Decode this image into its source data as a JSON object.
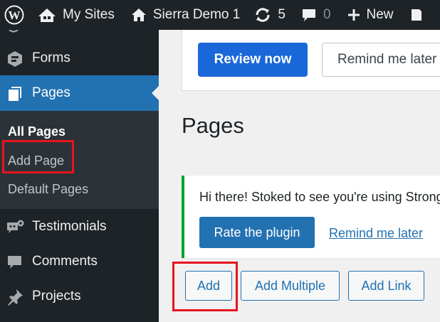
{
  "adminbar": {
    "my_sites": "My Sites",
    "site_name": "Sierra Demo 1",
    "updates_count": "5",
    "comments_count": "0",
    "new_label": "New"
  },
  "sidebar": {
    "items": [
      {
        "label": "Forms",
        "icon": "forms-icon"
      },
      {
        "label": "Pages",
        "icon": "pages-icon",
        "active": true
      },
      {
        "label": "Testimonials",
        "icon": "testimonials-icon"
      },
      {
        "label": "Comments",
        "icon": "comments-icon"
      },
      {
        "label": "Projects",
        "icon": "projects-icon"
      }
    ],
    "submenu": [
      {
        "label": "All Pages",
        "current": true
      },
      {
        "label": "Add Page"
      },
      {
        "label": "Default Pages"
      }
    ]
  },
  "main": {
    "review_notice": {
      "review_now": "Review now",
      "remind_later": "Remind me later"
    },
    "page_title": "Pages",
    "notice": {
      "text": "Hi there! Stoked to see you're using Strong Testimonials",
      "rate_button": "Rate the plugin",
      "remind_link": "Remind me later"
    },
    "actions": {
      "add": "Add",
      "add_multiple": "Add Multiple",
      "add_link": "Add Link"
    }
  },
  "colors": {
    "adminbar_bg": "#1d2327",
    "sidebar_submenu_bg": "#2c3338",
    "active_menu_bg": "#2271b1",
    "review_button_bg": "#1a67d9",
    "notice_border_success": "#00a32a",
    "highlight_box": "#e8141d"
  }
}
